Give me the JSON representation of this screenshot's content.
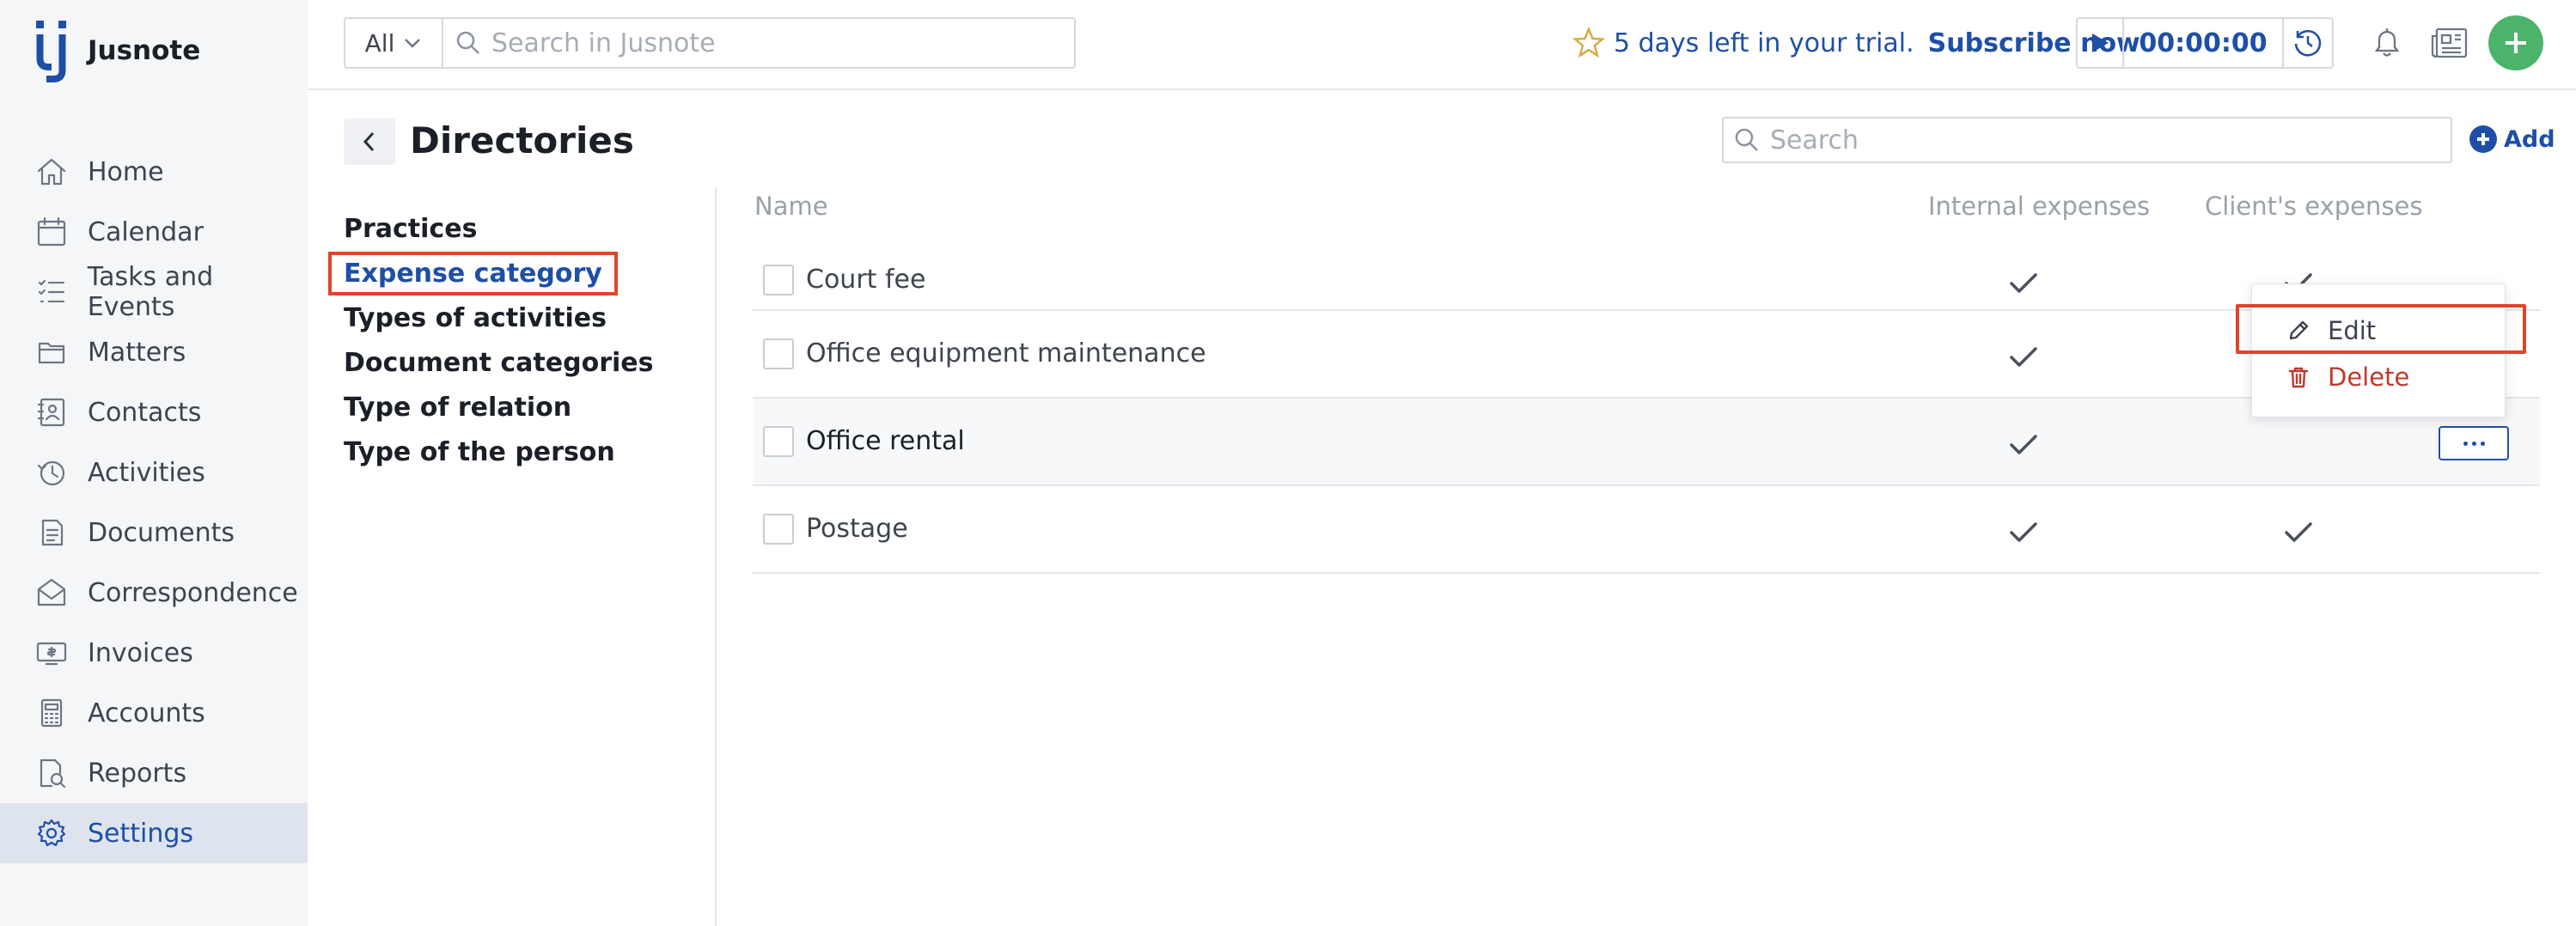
{
  "app": {
    "name": "Jusnote"
  },
  "sidebar": {
    "items": [
      {
        "label": "Home",
        "icon": "home-icon"
      },
      {
        "label": "Calendar",
        "icon": "calendar-icon"
      },
      {
        "label": "Tasks and Events",
        "icon": "tasks-icon"
      },
      {
        "label": "Matters",
        "icon": "matters-icon"
      },
      {
        "label": "Contacts",
        "icon": "contacts-icon"
      },
      {
        "label": "Activities",
        "icon": "activities-icon"
      },
      {
        "label": "Documents",
        "icon": "documents-icon"
      },
      {
        "label": "Correspondence",
        "icon": "correspondence-icon"
      },
      {
        "label": "Invoices",
        "icon": "invoices-icon"
      },
      {
        "label": "Accounts",
        "icon": "accounts-icon"
      },
      {
        "label": "Reports",
        "icon": "reports-icon"
      },
      {
        "label": "Settings",
        "icon": "gear-icon",
        "active": true
      }
    ]
  },
  "topbar": {
    "search_scope": "All",
    "search_placeholder": "Search in Jusnote",
    "trial_text": "5 days left in your trial.",
    "subscribe_label": "Subscribe now",
    "timer_value": "00:00:00"
  },
  "page": {
    "title": "Directories",
    "search_placeholder": "Search",
    "add_label": "Add"
  },
  "directories": [
    {
      "label": "Practices"
    },
    {
      "label": "Expense category",
      "active": true
    },
    {
      "label": "Types of activities"
    },
    {
      "label": "Document categories"
    },
    {
      "label": "Type of relation"
    },
    {
      "label": "Type of the person"
    }
  ],
  "table": {
    "columns": {
      "name": "Name",
      "internal": "Internal expenses",
      "client": "Client's expenses"
    },
    "rows": [
      {
        "name": "Court fee",
        "internal": true,
        "client": true
      },
      {
        "name": "Office equipment maintenance",
        "internal": true,
        "client": true
      },
      {
        "name": "Office rental",
        "internal": true,
        "client": false
      },
      {
        "name": "Postage",
        "internal": true,
        "client": true
      }
    ]
  },
  "context_menu": {
    "edit_label": "Edit",
    "delete_label": "Delete"
  },
  "colors": {
    "accent": "#1e4fa6",
    "add_button": "#4cb36b",
    "highlight": "#e0442b",
    "danger": "#c0392b",
    "star": "#d7a93a"
  }
}
